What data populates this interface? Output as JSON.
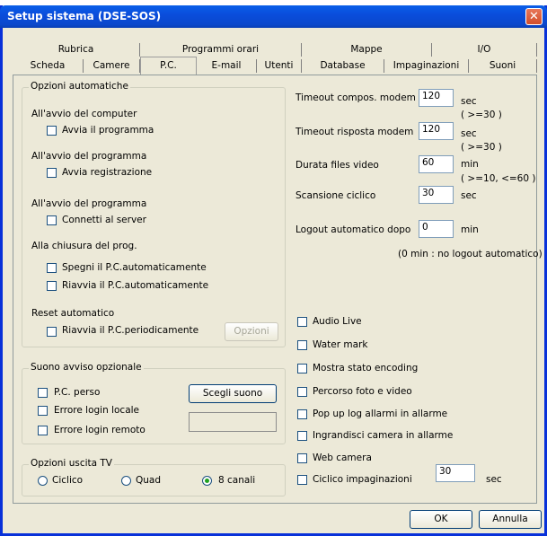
{
  "window": {
    "title": "Setup sistema (DSE-SOS)",
    "close": "✕"
  },
  "tabs_row1": [
    "Rubrica",
    "Programmi orari",
    "Mappe",
    "I/O"
  ],
  "tabs_row2": [
    "Scheda",
    "Camere",
    "P.C.",
    "E-mail",
    "Utenti",
    "Database",
    "Impaginazioni",
    "Suoni"
  ],
  "auto": {
    "title": "Opzioni automatiche",
    "avvio_pc": "All'avvio del computer",
    "avvia_programma": "Avvia il programma",
    "avvio_prog1": "All'avvio del programma",
    "avvia_registrazione": "Avvia registrazione",
    "avvio_prog2": "All'avvio del programma",
    "connetti": "Connetti al server",
    "chiusura": "Alla chiusura del prog.",
    "spegni": "Spegni il P.C.automaticamente",
    "riavvia": "Riavvia il P.C.automaticamente",
    "reset": "Reset automatico",
    "riavvia_period": "Riavvia il P.C.periodicamente",
    "opzioni_btn": "Opzioni"
  },
  "suono": {
    "title": "Suono avviso opzionale",
    "pc_perso": "P.C. perso",
    "errore_locale": "Errore login locale",
    "errore_remoto": "Errore login remoto",
    "scegli": "Scegli suono"
  },
  "tv": {
    "title": "Opzioni uscita TV",
    "ciclico": "Ciclico",
    "quad": "Quad",
    "canali": "8 canali",
    "selected": "8 canali"
  },
  "fields": {
    "timeout_modem": {
      "label": "Timeout compos. modem",
      "value": "120",
      "unit": "sec",
      "hint": "( >=30 )"
    },
    "timeout_risposta": {
      "label": "Timeout risposta modem",
      "value": "120",
      "unit": "sec",
      "hint": "( >=30 )"
    },
    "durata_video": {
      "label": "Durata files video",
      "value": "60",
      "unit": "min",
      "hint": "( >=10, <=60 )"
    },
    "scansione": {
      "label": "Scansione ciclico",
      "value": "30",
      "unit": "sec"
    },
    "logout": {
      "label": "Logout automatico dopo",
      "value": "0",
      "unit": "min",
      "hint": "(0 min : no logout automatico)"
    }
  },
  "right_checks": {
    "audio": "Audio Live",
    "water": "Water mark",
    "stato": "Mostra stato encoding",
    "percorso": "Percorso foto e video",
    "popup": "Pop up log allarmi in allarme",
    "ingrandisci": "Ingrandisci camera in allarme",
    "web": "Web camera",
    "ciclico": "Ciclico impaginazioni",
    "ciclico_value": "30",
    "ciclico_unit": "sec"
  },
  "footer": {
    "ok": "OK",
    "annulla": "Annulla"
  }
}
